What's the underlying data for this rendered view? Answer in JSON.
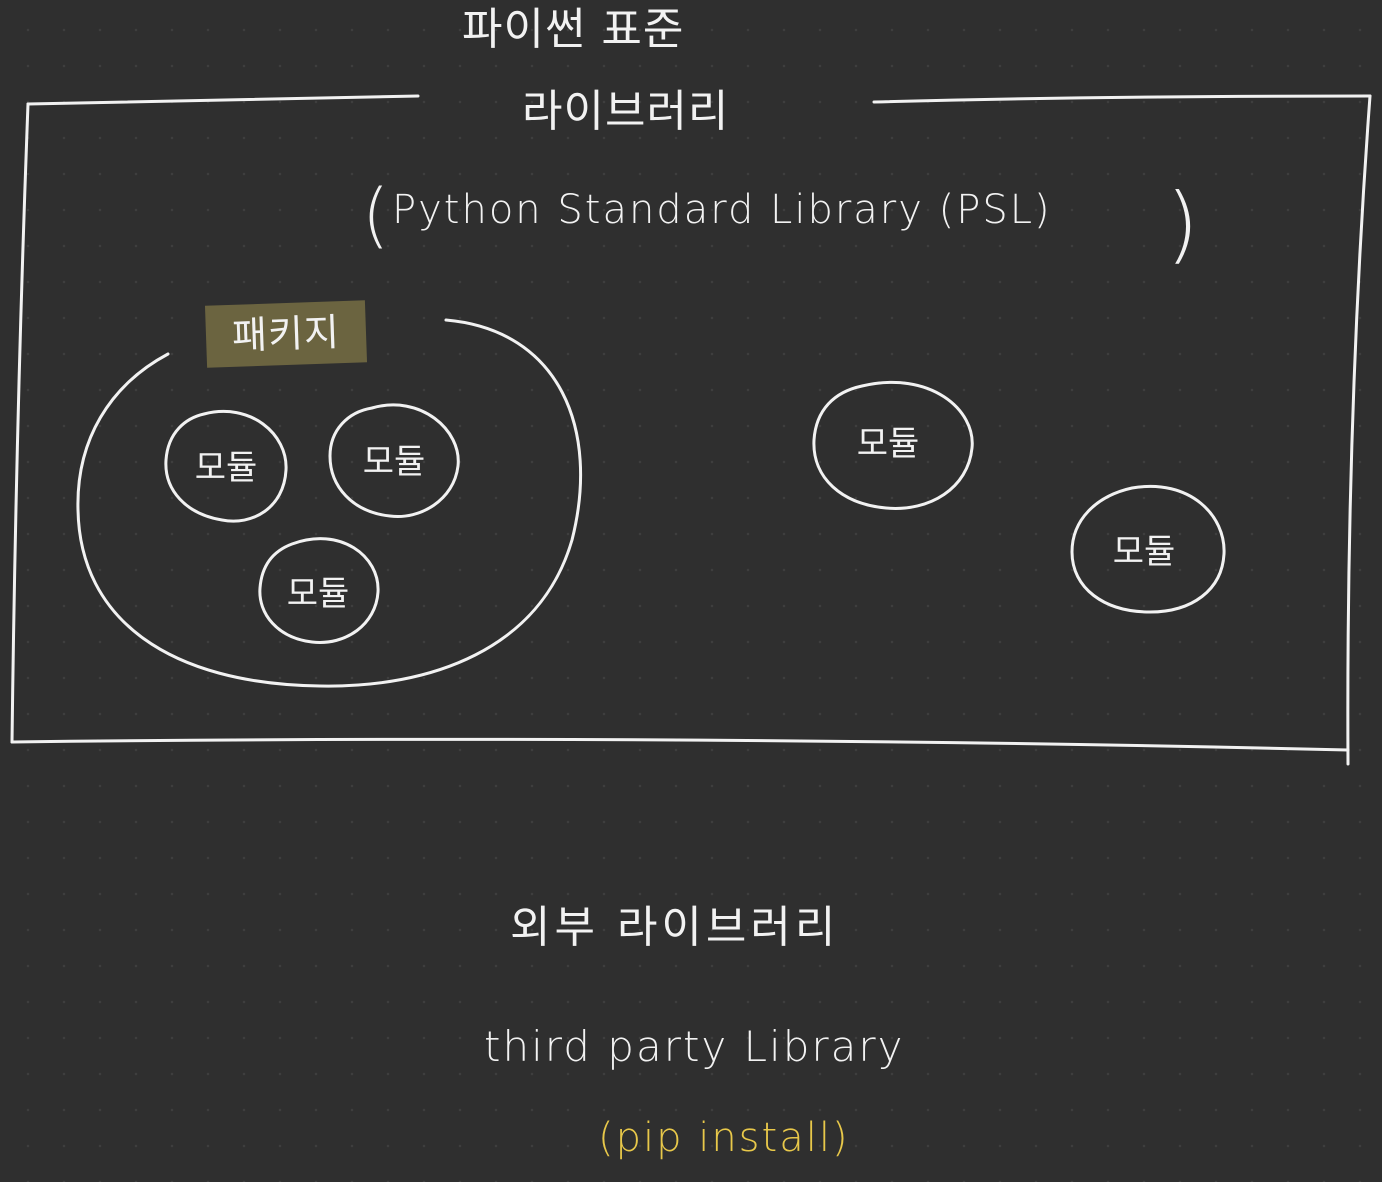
{
  "diagram": {
    "title_ko_line1": "파이썬 표준",
    "title_ko_line2": "라이브러리",
    "title_en": "Python Standard Library (PSL)",
    "paren_open": "(",
    "paren_close": ")",
    "package_label": "패키지",
    "module_label": "모듈",
    "external_ko": "외부 라이브러리",
    "external_en": "third party Library",
    "external_pip": "(pip install)"
  },
  "colors": {
    "background": "#2f2f2f",
    "stroke": "#f2f2f2",
    "package_highlight": "#6b6440",
    "pip_text": "#e8c84a"
  }
}
